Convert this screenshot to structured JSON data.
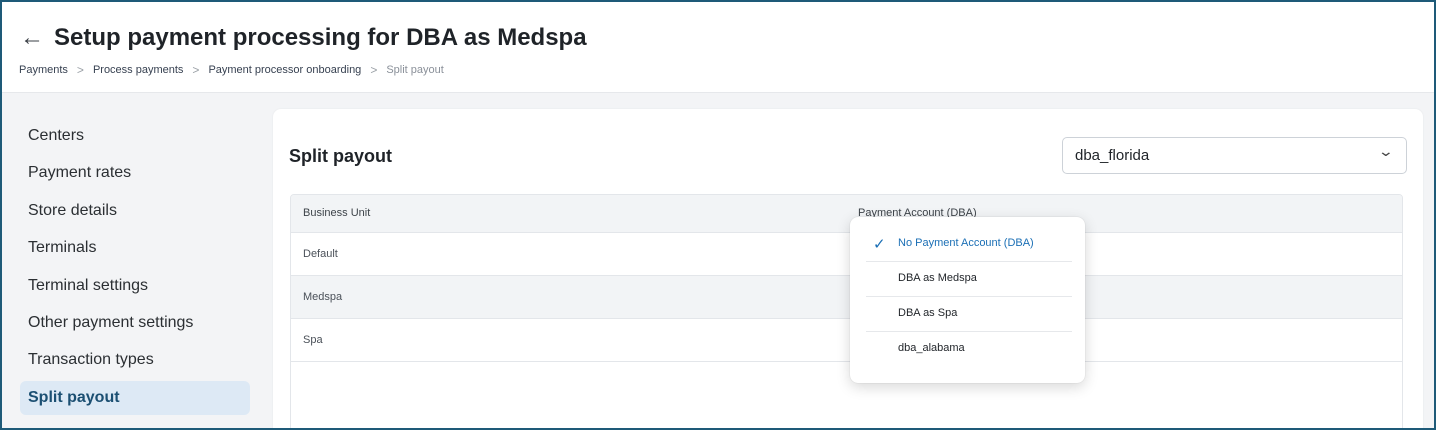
{
  "header": {
    "title": "Setup payment processing for DBA as Medspa",
    "breadcrumbs": [
      "Payments",
      "Process payments",
      "Payment processor onboarding",
      "Split payout"
    ]
  },
  "sidebar": {
    "items": [
      {
        "label": "Centers"
      },
      {
        "label": "Payment rates"
      },
      {
        "label": "Store details"
      },
      {
        "label": "Terminals"
      },
      {
        "label": "Terminal settings"
      },
      {
        "label": "Other payment settings"
      },
      {
        "label": "Transaction types"
      },
      {
        "label": "Split payout",
        "active": true
      }
    ]
  },
  "main": {
    "title": "Split payout",
    "select": {
      "value": "dba_florida"
    },
    "table": {
      "columns": [
        "Business Unit",
        "Payment Account (DBA)"
      ],
      "rows": [
        {
          "unit": "Default"
        },
        {
          "unit": "Medspa"
        },
        {
          "unit": "Spa"
        }
      ]
    },
    "dropdown": {
      "options": [
        {
          "label": "No Payment Account (DBA)",
          "selected": true
        },
        {
          "label": "DBA as Medspa"
        },
        {
          "label": "DBA as Spa"
        },
        {
          "label": "dba_alabama"
        }
      ]
    }
  },
  "colors": {
    "accent": "#1b6fb5",
    "active_bg": "#dde9f5",
    "frame_border": "#1e5a78"
  },
  "icons": {
    "back": "arrow-left-icon",
    "chevron": "chevron-down-icon",
    "check": "check-icon",
    "separator": "chevron-right-icon"
  }
}
